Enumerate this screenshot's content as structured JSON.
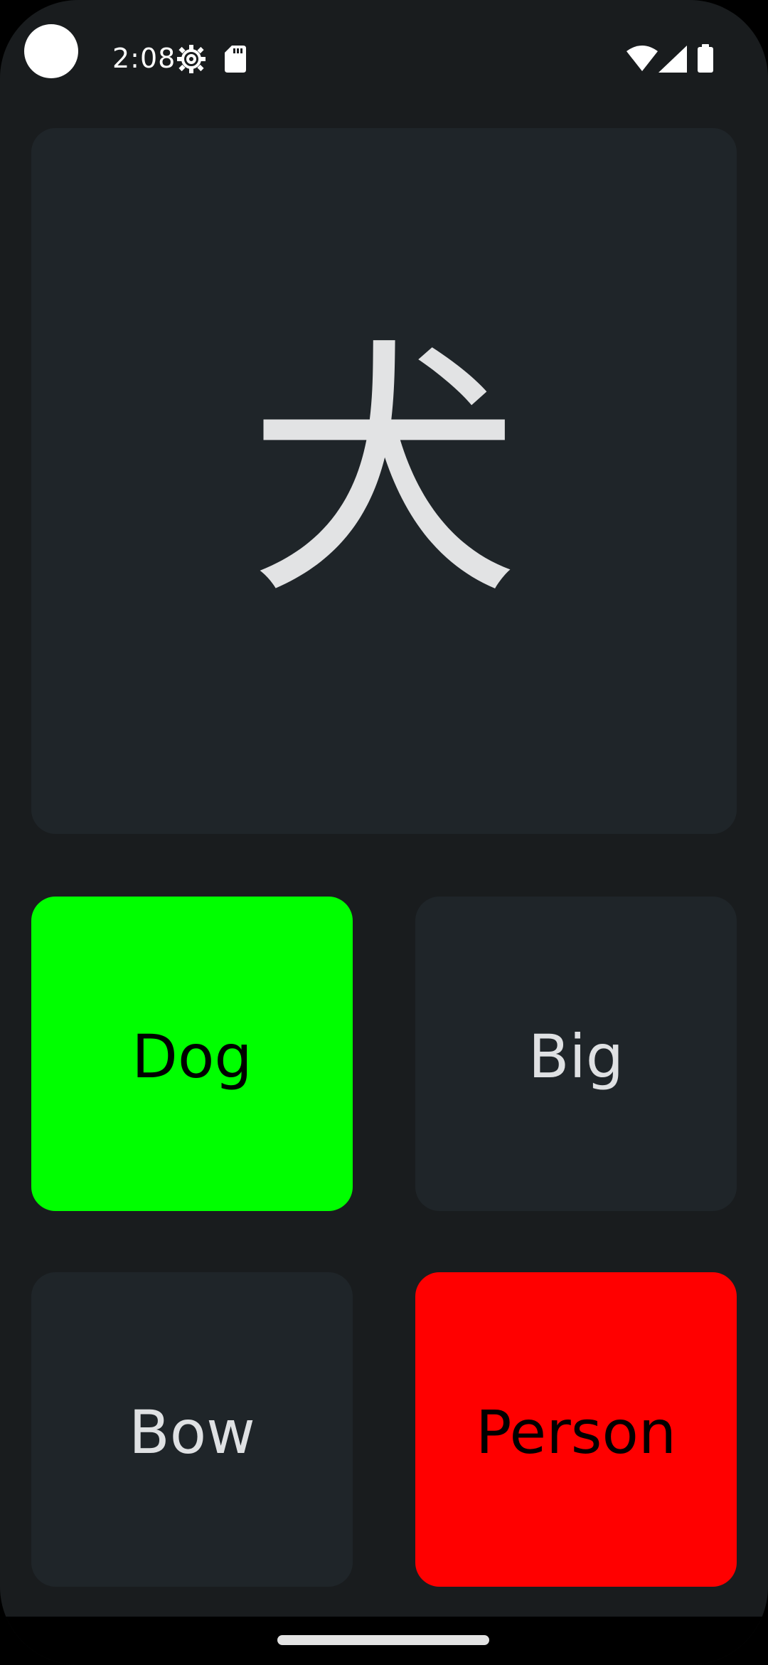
{
  "status_bar": {
    "time": "2:08",
    "icons": [
      "settings-gear-icon",
      "sd-card-icon",
      "wifi-icon",
      "cell-signal-icon",
      "battery-icon"
    ]
  },
  "prompt": {
    "character": "犬"
  },
  "answers": [
    {
      "label": "Dog",
      "state": "correct",
      "color": "#00ff00"
    },
    {
      "label": "Big",
      "state": "neutral",
      "color": "#1f2529"
    },
    {
      "label": "Bow",
      "state": "neutral",
      "color": "#1f2529"
    },
    {
      "label": "Person",
      "state": "wrong",
      "color": "#ff0000"
    }
  ],
  "colors": {
    "background": "#191c1e",
    "card": "#1f2529",
    "correct": "#00ff00",
    "wrong": "#ff0000",
    "text": "#dfe1e3"
  }
}
